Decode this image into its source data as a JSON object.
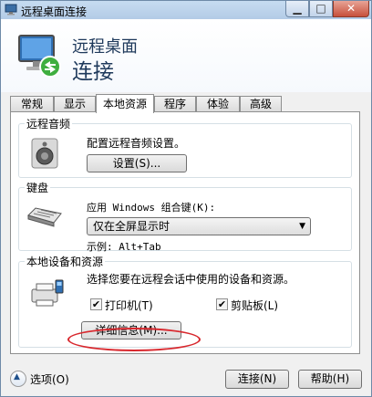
{
  "window": {
    "title": "远程桌面连接"
  },
  "header": {
    "subtitle": "远程桌面",
    "title": "连接"
  },
  "tabs": [
    {
      "label": "常规"
    },
    {
      "label": "显示"
    },
    {
      "label": "本地资源"
    },
    {
      "label": "程序"
    },
    {
      "label": "体验"
    },
    {
      "label": "高级"
    }
  ],
  "remote_audio": {
    "group_label": "远程音频",
    "description": "配置远程音频设置。",
    "settings_button": "设置(S)..."
  },
  "keyboard": {
    "group_label": "键盘",
    "description": "应用 Windows 组合键(K):",
    "selected_option": "仅在全屏显示时",
    "example": "示例: Alt+Tab"
  },
  "local_devices": {
    "group_label": "本地设备和资源",
    "description": "选择您要在远程会话中使用的设备和资源。",
    "printer_label": "打印机(T)",
    "printer_checked": true,
    "clipboard_label": "剪贴板(L)",
    "clipboard_checked": true,
    "details_button": "详细信息(M)..."
  },
  "footer": {
    "options_label": "选项(O)",
    "connect_button": "连接(N)",
    "help_button": "帮助(H)"
  },
  "colors": {
    "accent_text": "#1e395b",
    "highlight_ellipse": "#d8272d"
  }
}
